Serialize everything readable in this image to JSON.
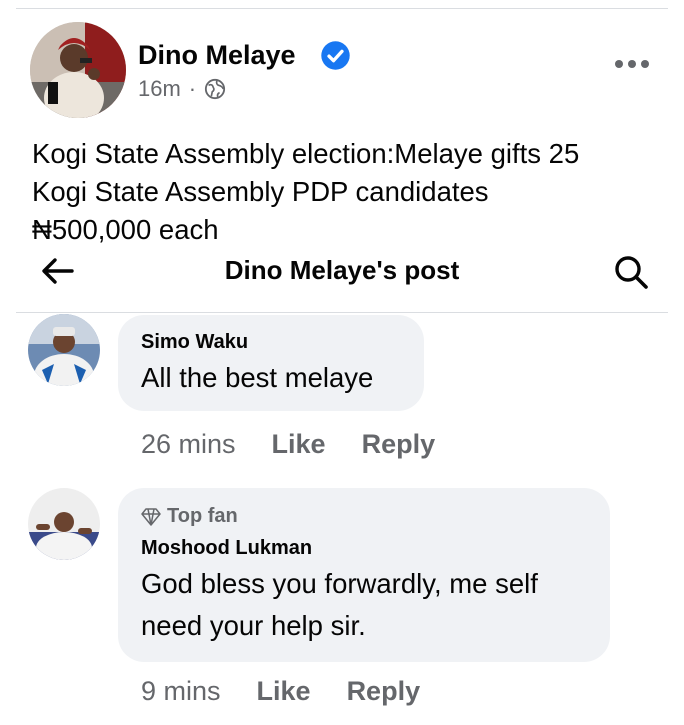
{
  "post": {
    "author": "Dino Melaye",
    "time": "16m",
    "separator": "·",
    "text_lines": [
      "Kogi State Assembly election:Melaye gifts 25",
      "Kogi State Assembly PDP candidates",
      "₦500,000 each"
    ]
  },
  "nav": {
    "title": "Dino Melaye's post"
  },
  "comments": [
    {
      "name": "Simo Waku",
      "text": "All the best melaye",
      "time": "26 mins",
      "like": "Like",
      "reply": "Reply"
    },
    {
      "badge": "Top fan",
      "name": "Moshood Lukman",
      "text_lines": [
        "God bless you forwardly, me self",
        "need your help sir."
      ],
      "time": "9 mins",
      "like": "Like",
      "reply": "Reply"
    }
  ],
  "colors": {
    "verified": "#1877f2",
    "secondary_text": "#65676b",
    "bubble": "#f0f2f5"
  },
  "icons": [
    "verified-badge-icon",
    "globe-icon",
    "more-options-icon",
    "back-arrow-icon",
    "search-icon",
    "diamond-icon"
  ]
}
